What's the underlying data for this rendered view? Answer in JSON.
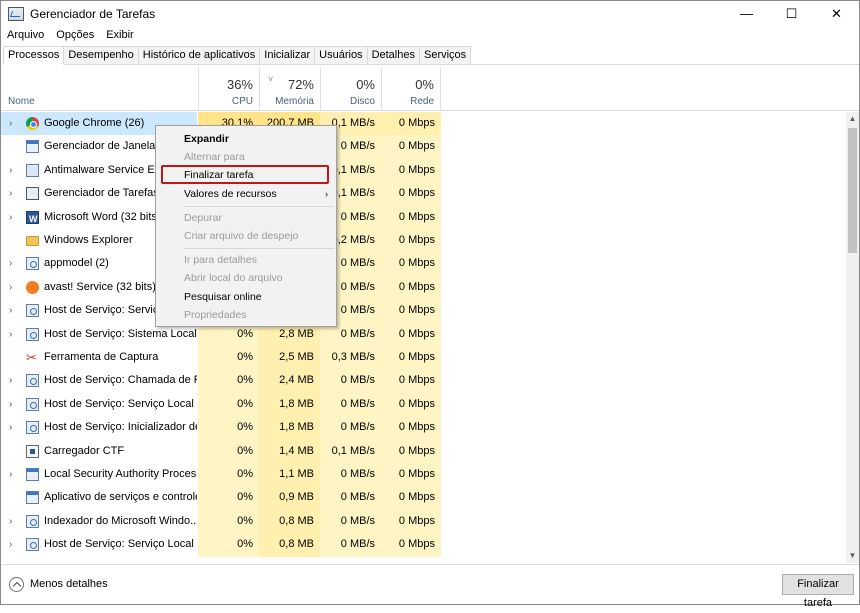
{
  "window": {
    "title": "Gerenciador de Tarefas",
    "minimize_glyph": "—",
    "maximize_glyph": "☐",
    "close_glyph": "✕"
  },
  "menu": [
    "Arquivo",
    "Opções",
    "Exibir"
  ],
  "tabs": [
    {
      "label": "Processos",
      "active": true
    },
    {
      "label": "Desempenho"
    },
    {
      "label": "Histórico de aplicativos"
    },
    {
      "label": "Inicializar"
    },
    {
      "label": "Usuários"
    },
    {
      "label": "Detalhes"
    },
    {
      "label": "Serviços"
    }
  ],
  "columns": {
    "name": "Nome",
    "cpu": {
      "pct": "36%",
      "label": "CPU"
    },
    "memory": {
      "pct": "72%",
      "label": "Memória"
    },
    "disk": {
      "pct": "0%",
      "label": "Disco"
    },
    "network": {
      "pct": "0%",
      "label": "Rede"
    }
  },
  "rows": [
    {
      "name": "Google Chrome (26)",
      "icon": "chrome-icon",
      "expandable": true,
      "cpu": "30,1%",
      "mem": "200,7 MB",
      "disk": "0,1 MB/s",
      "net": "0 Mbps"
    },
    {
      "name": "Gerenciador de Janelas da",
      "icon": "window-icon",
      "expandable": false,
      "cpu": "",
      "mem": "",
      "disk": "0 MB/s",
      "net": "0 Mbps"
    },
    {
      "name": "Antimalware Service Exec",
      "icon": "shield-icon",
      "expandable": true,
      "cpu": "",
      "mem": "",
      "disk": "0,1 MB/s",
      "net": "0 Mbps"
    },
    {
      "name": "Gerenciador de Tarefas",
      "icon": "task-manager-icon",
      "expandable": true,
      "cpu": "",
      "mem": "",
      "disk": "0,1 MB/s",
      "net": "0 Mbps"
    },
    {
      "name": "Microsoft Word (32 bits)",
      "icon": "word-icon",
      "expandable": true,
      "cpu": "",
      "mem": "",
      "disk": "0 MB/s",
      "net": "0 Mbps"
    },
    {
      "name": "Windows Explorer",
      "icon": "folder-icon",
      "expandable": false,
      "cpu": "",
      "mem": "",
      "disk": "0,2 MB/s",
      "net": "0 Mbps"
    },
    {
      "name": "appmodel (2)",
      "icon": "gear-icon",
      "expandable": true,
      "cpu": "",
      "mem": "",
      "disk": "0 MB/s",
      "net": "0 Mbps"
    },
    {
      "name": "avast! Service (32 bits)",
      "icon": "avast-icon",
      "expandable": true,
      "cpu": "",
      "mem": "",
      "disk": "0 MB/s",
      "net": "0 Mbps"
    },
    {
      "name": "Host de Serviço: Serviço d",
      "icon": "gear-icon",
      "expandable": true,
      "cpu": "",
      "mem": "",
      "disk": "0 MB/s",
      "net": "0 Mbps"
    },
    {
      "name": "Host de Serviço: Sistema Local (...",
      "icon": "gear-icon",
      "expandable": true,
      "cpu": "0%",
      "mem": "2,8 MB",
      "disk": "0 MB/s",
      "net": "0 Mbps"
    },
    {
      "name": "Ferramenta de Captura",
      "icon": "scissors-icon",
      "expandable": false,
      "cpu": "0%",
      "mem": "2,5 MB",
      "disk": "0,3 MB/s",
      "net": "0 Mbps"
    },
    {
      "name": "Host de Serviço: Chamada de P...",
      "icon": "gear-icon",
      "expandable": true,
      "cpu": "0%",
      "mem": "2,4 MB",
      "disk": "0 MB/s",
      "net": "0 Mbps"
    },
    {
      "name": "Host de Serviço: Serviço Local (...",
      "icon": "gear-icon",
      "expandable": true,
      "cpu": "0%",
      "mem": "1,8 MB",
      "disk": "0 MB/s",
      "net": "0 Mbps"
    },
    {
      "name": "Host de Serviço: Inicializador de...",
      "icon": "gear-icon",
      "expandable": true,
      "cpu": "0%",
      "mem": "1,8 MB",
      "disk": "0 MB/s",
      "net": "0 Mbps"
    },
    {
      "name": "Carregador CTF",
      "icon": "ctf-icon",
      "expandable": false,
      "cpu": "0%",
      "mem": "1,4 MB",
      "disk": "0,1 MB/s",
      "net": "0 Mbps"
    },
    {
      "name": "Local Security Authority Proces...",
      "icon": "window-icon",
      "expandable": true,
      "cpu": "0%",
      "mem": "1,1 MB",
      "disk": "0 MB/s",
      "net": "0 Mbps"
    },
    {
      "name": "Aplicativo de serviços e controle",
      "icon": "window-icon",
      "expandable": false,
      "cpu": "0%",
      "mem": "0,9 MB",
      "disk": "0 MB/s",
      "net": "0 Mbps"
    },
    {
      "name": "Indexador do Microsoft Windo...",
      "icon": "gear-icon",
      "expandable": true,
      "cpu": "0%",
      "mem": "0,8 MB",
      "disk": "0 MB/s",
      "net": "0 Mbps"
    },
    {
      "name": "Host de Serviço: Serviço Local (...",
      "icon": "gear-icon",
      "expandable": true,
      "cpu": "0%",
      "mem": "0,8 MB",
      "disk": "0 MB/s",
      "net": "0 Mbps"
    }
  ],
  "context_menu": {
    "items": [
      {
        "label": "Expandir",
        "bold": true,
        "disabled": false
      },
      {
        "label": "Alternar para",
        "disabled": true
      },
      {
        "label": "Finalizar tarefa",
        "disabled": false,
        "highlighted": true
      },
      {
        "label": "Valores de recursos",
        "disabled": false,
        "submenu": true
      },
      {
        "label": "Depurar",
        "disabled": true
      },
      {
        "label": "Criar arquivo de despejo",
        "disabled": true
      },
      {
        "label": "Ir para detalhes",
        "disabled": true
      },
      {
        "label": "Abrir local do arquivo",
        "disabled": true
      },
      {
        "label": "Pesquisar online",
        "disabled": false
      },
      {
        "label": "Propriedades",
        "disabled": true
      }
    ],
    "submenu_glyph": "›"
  },
  "footer": {
    "less_details": "Menos detalhes",
    "end_task": "Finalizar tarefa"
  },
  "colors": {
    "selected_row": "#cce8ff",
    "heat_light": "#fff4c4",
    "heat_medium": "#ffe48a",
    "highlight_border": "#c01818"
  }
}
